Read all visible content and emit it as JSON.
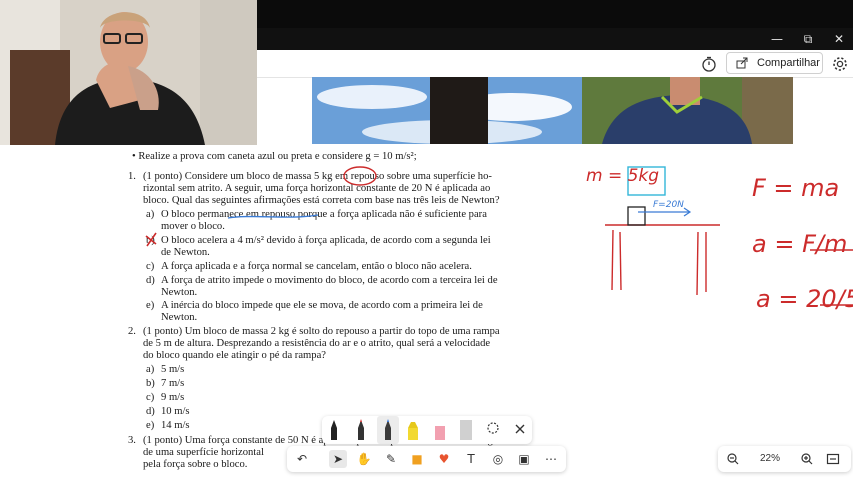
{
  "window": {
    "minimize": "—",
    "maximize": "⧉",
    "close": "✕"
  },
  "toolbar": {
    "share_label": "Compartilhar"
  },
  "doc": {
    "intro": "• Realize a prova com caneta azul ou preta e considere g = 10 m/s²;",
    "q1": {
      "number": "1.",
      "lines": [
        "(1 ponto) Considere um bloco de massa 5 kg em repouso sobre uma superfície ho-",
        "rizontal sem atrito. A seguir, uma força horizontal constante de 20 N é aplicada ao",
        "bloco. Qual das seguintes afirmações está correta com base nas três leis de Newton?"
      ],
      "options": [
        {
          "key": "a)",
          "lines": [
            "O bloco permanece em repouso porque a força aplicada não é suficiente para",
            "mover o bloco."
          ]
        },
        {
          "key": "b)",
          "lines": [
            "O bloco acelera a 4 m/s² devido à força aplicada, de acordo com a segunda lei",
            "de Newton."
          ]
        },
        {
          "key": "c)",
          "lines": [
            "A força aplicada e a força normal se cancelam, então o bloco não acelera."
          ]
        },
        {
          "key": "d)",
          "lines": [
            "A força de atrito impede o movimento do bloco, de acordo com a terceira lei de",
            "Newton."
          ]
        },
        {
          "key": "e)",
          "lines": [
            "A inércia do bloco impede que ele se mova, de acordo com a primeira lei de",
            "Newton."
          ]
        }
      ]
    },
    "q2": {
      "number": "2.",
      "lines": [
        "(1 ponto) Um bloco de massa 2 kg é solto do repouso a partir do topo de uma rampa",
        "de 5 m de altura. Desprezando a resistência do ar e o atrito, qual será a velocidade",
        "do bloco quando ele atingir o pé da rampa?"
      ],
      "options": [
        {
          "key": "a)",
          "text": "5 m/s"
        },
        {
          "key": "b)",
          "text": "7 m/s"
        },
        {
          "key": "c)",
          "text": "9 m/s"
        },
        {
          "key": "d)",
          "text": "10 m/s"
        },
        {
          "key": "e)",
          "text": "14 m/s"
        }
      ]
    },
    "q3": {
      "number": "3.",
      "lines": [
        "(1 ponto) Uma força constante de 50 N é aplicada para empurrar um bloco ao longo",
        "de uma superfície horizontal",
        "pela força sobre o bloco."
      ]
    }
  },
  "handwriting": {
    "mass": "m = 5kg",
    "force": "F=20N",
    "law": "F = ma",
    "step1": "a = F/m",
    "step2": "a = 20/5"
  },
  "zoom": {
    "level": "22%"
  },
  "colors": {
    "ink_red": "#cc2b2b",
    "ink_blue": "#3a7bd5",
    "highlight_cyan": "#34b6d8"
  }
}
